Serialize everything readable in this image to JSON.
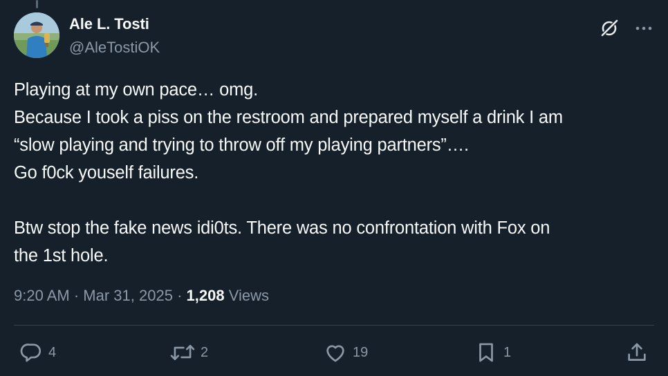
{
  "author": {
    "display_name": "Ale L. Tosti",
    "handle": "@AleTostiOK",
    "avatar_icon": "profile-photo-golfer-with-trophy"
  },
  "header_icons": {
    "grok": "grok-icon",
    "more": "more-icon"
  },
  "tweet": {
    "lines": [
      "Playing at my own pace… omg.",
      "Because I took a piss on the restroom and prepared myself a drink I am",
      "“slow playing and trying to throw off my playing partners”….",
      "Go f0ck youself failures.",
      "",
      "Btw stop the fake news idi0ts. There was no confrontation with Fox on",
      "the 1st hole."
    ]
  },
  "meta": {
    "time": "9:20 AM",
    "separator": "·",
    "date": "Mar 31, 2025",
    "views_count": "1,208",
    "views_label": "Views"
  },
  "actions": {
    "reply": {
      "icon": "reply-icon",
      "count": "4"
    },
    "retweet": {
      "icon": "retweet-icon",
      "count": "2"
    },
    "like": {
      "icon": "heart-icon",
      "count": "19"
    },
    "bookmark": {
      "icon": "bookmark-icon",
      "count": "1"
    },
    "share": {
      "icon": "share-icon"
    }
  },
  "colors": {
    "background": "#15202b",
    "text_primary": "#f7f9f9",
    "text_secondary": "#8b98a5",
    "divider": "#38444d"
  }
}
